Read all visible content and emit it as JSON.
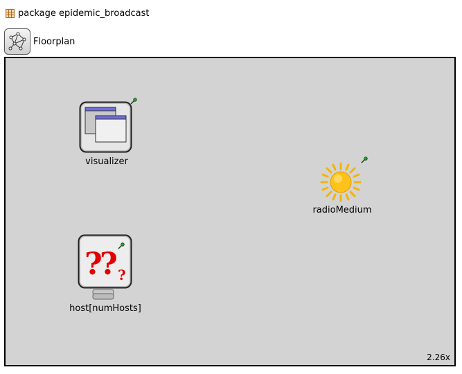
{
  "package": {
    "label": "package epidemic_broadcast",
    "icon": "package-icon"
  },
  "network": {
    "type_label": "Floorplan",
    "icon": "network-icon"
  },
  "canvas": {
    "background": "#d3d3d3",
    "zoom_label": "2.26x",
    "submodules": [
      {
        "name": "visualizer",
        "icon": "windows-icon"
      },
      {
        "name": "radioMedium",
        "icon": "sun-icon"
      },
      {
        "name": "host[numHosts]",
        "icon": "unknown-question-icon"
      }
    ]
  }
}
